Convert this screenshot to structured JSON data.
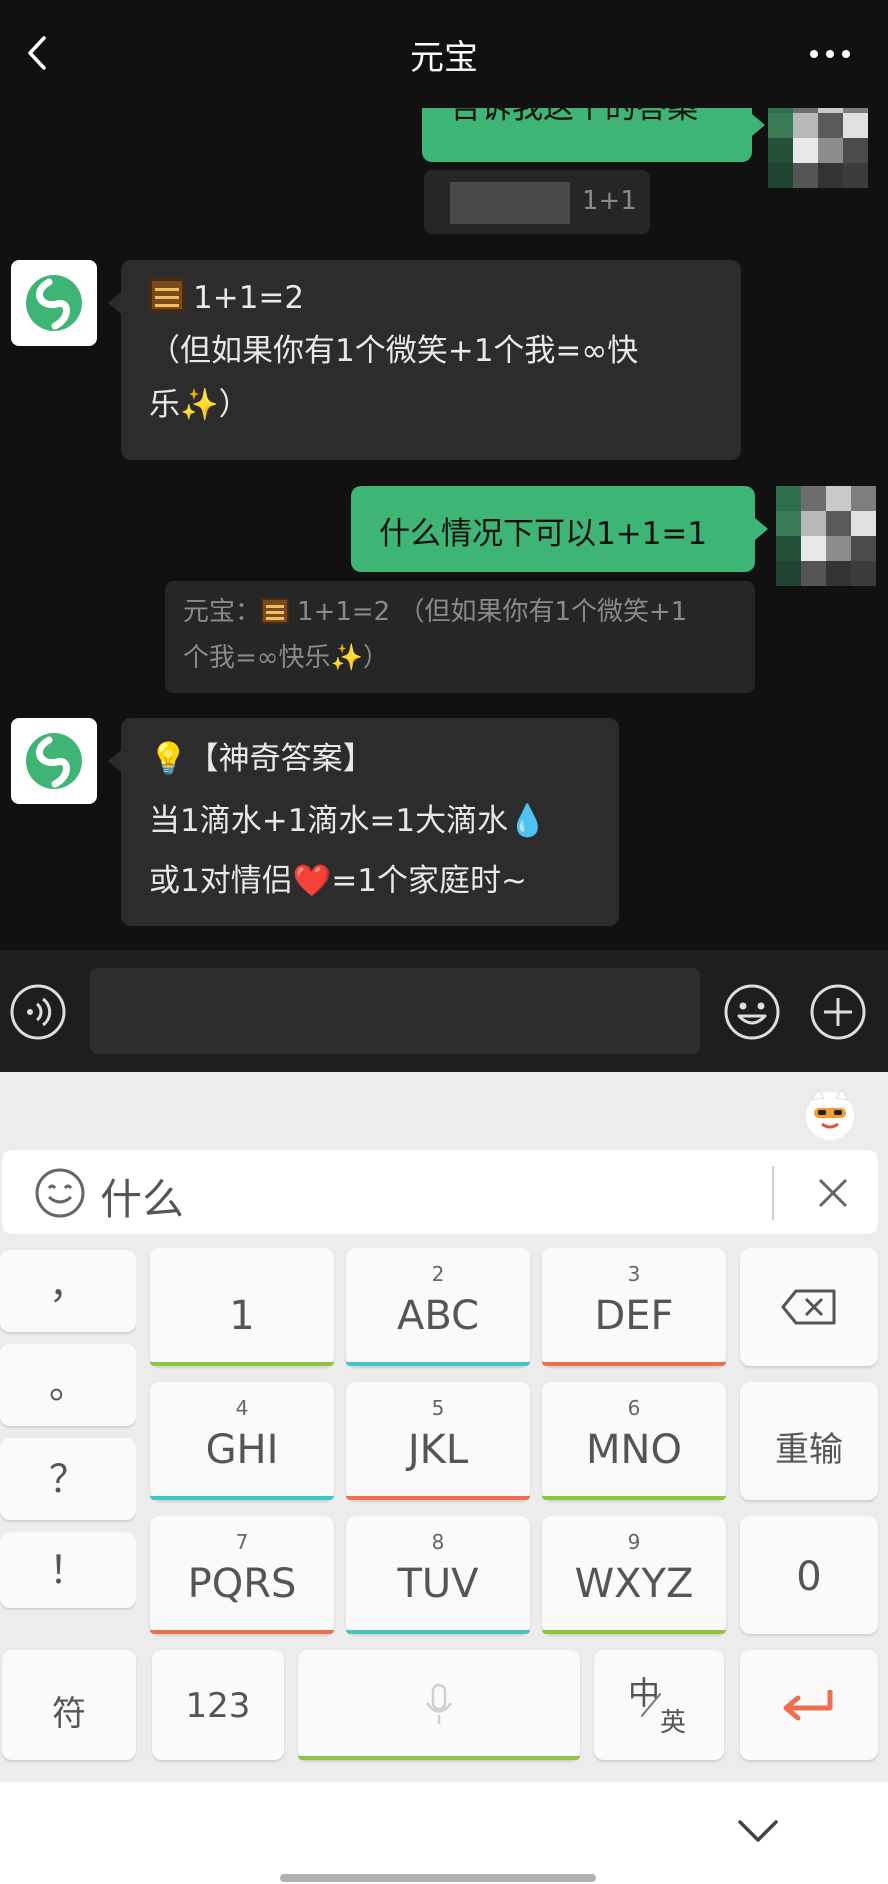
{
  "nav": {
    "title": "元宝"
  },
  "chat": {
    "msg1_text": "告诉我这个的答案",
    "quote1_text": "1+1",
    "bot1": {
      "line1": "1+1=2",
      "line2": "（但如果你有1个微笑+1个我=∞快",
      "line3": "乐✨）"
    },
    "msg2_text": "什么情况下可以1+1=1",
    "quote2": {
      "line1": "元宝：",
      "line1b": "1+1=2 （但如果你有1个微笑+1",
      "line2": "个我=∞快乐✨）"
    },
    "bot2": {
      "line1": "💡【神奇答案】",
      "line2": "当1滴水+1滴水=1大滴水💧",
      "line3": "或1对情侣❤️=1个家庭时~"
    }
  },
  "keyboard": {
    "candidate_text": "什么",
    "punctuation": [
      "，",
      "。",
      "？",
      "！"
    ],
    "keys": [
      {
        "num": "",
        "label": "1"
      },
      {
        "num": "2",
        "label": "ABC"
      },
      {
        "num": "3",
        "label": "DEF"
      },
      {
        "num": "4",
        "label": "GHI"
      },
      {
        "num": "5",
        "label": "JKL"
      },
      {
        "num": "6",
        "label": "MNO"
      },
      {
        "num": "7",
        "label": "PQRS"
      },
      {
        "num": "8",
        "label": "TUV"
      },
      {
        "num": "9",
        "label": "WXYZ"
      }
    ],
    "reenter_label": "重输",
    "zero_label": "0",
    "symbol_label": "符",
    "num_label": "123",
    "zh_label": "中",
    "en_label": "英"
  },
  "colors": {
    "accent_green": "#3eb575",
    "enter_orange": "#ee6f4e"
  }
}
